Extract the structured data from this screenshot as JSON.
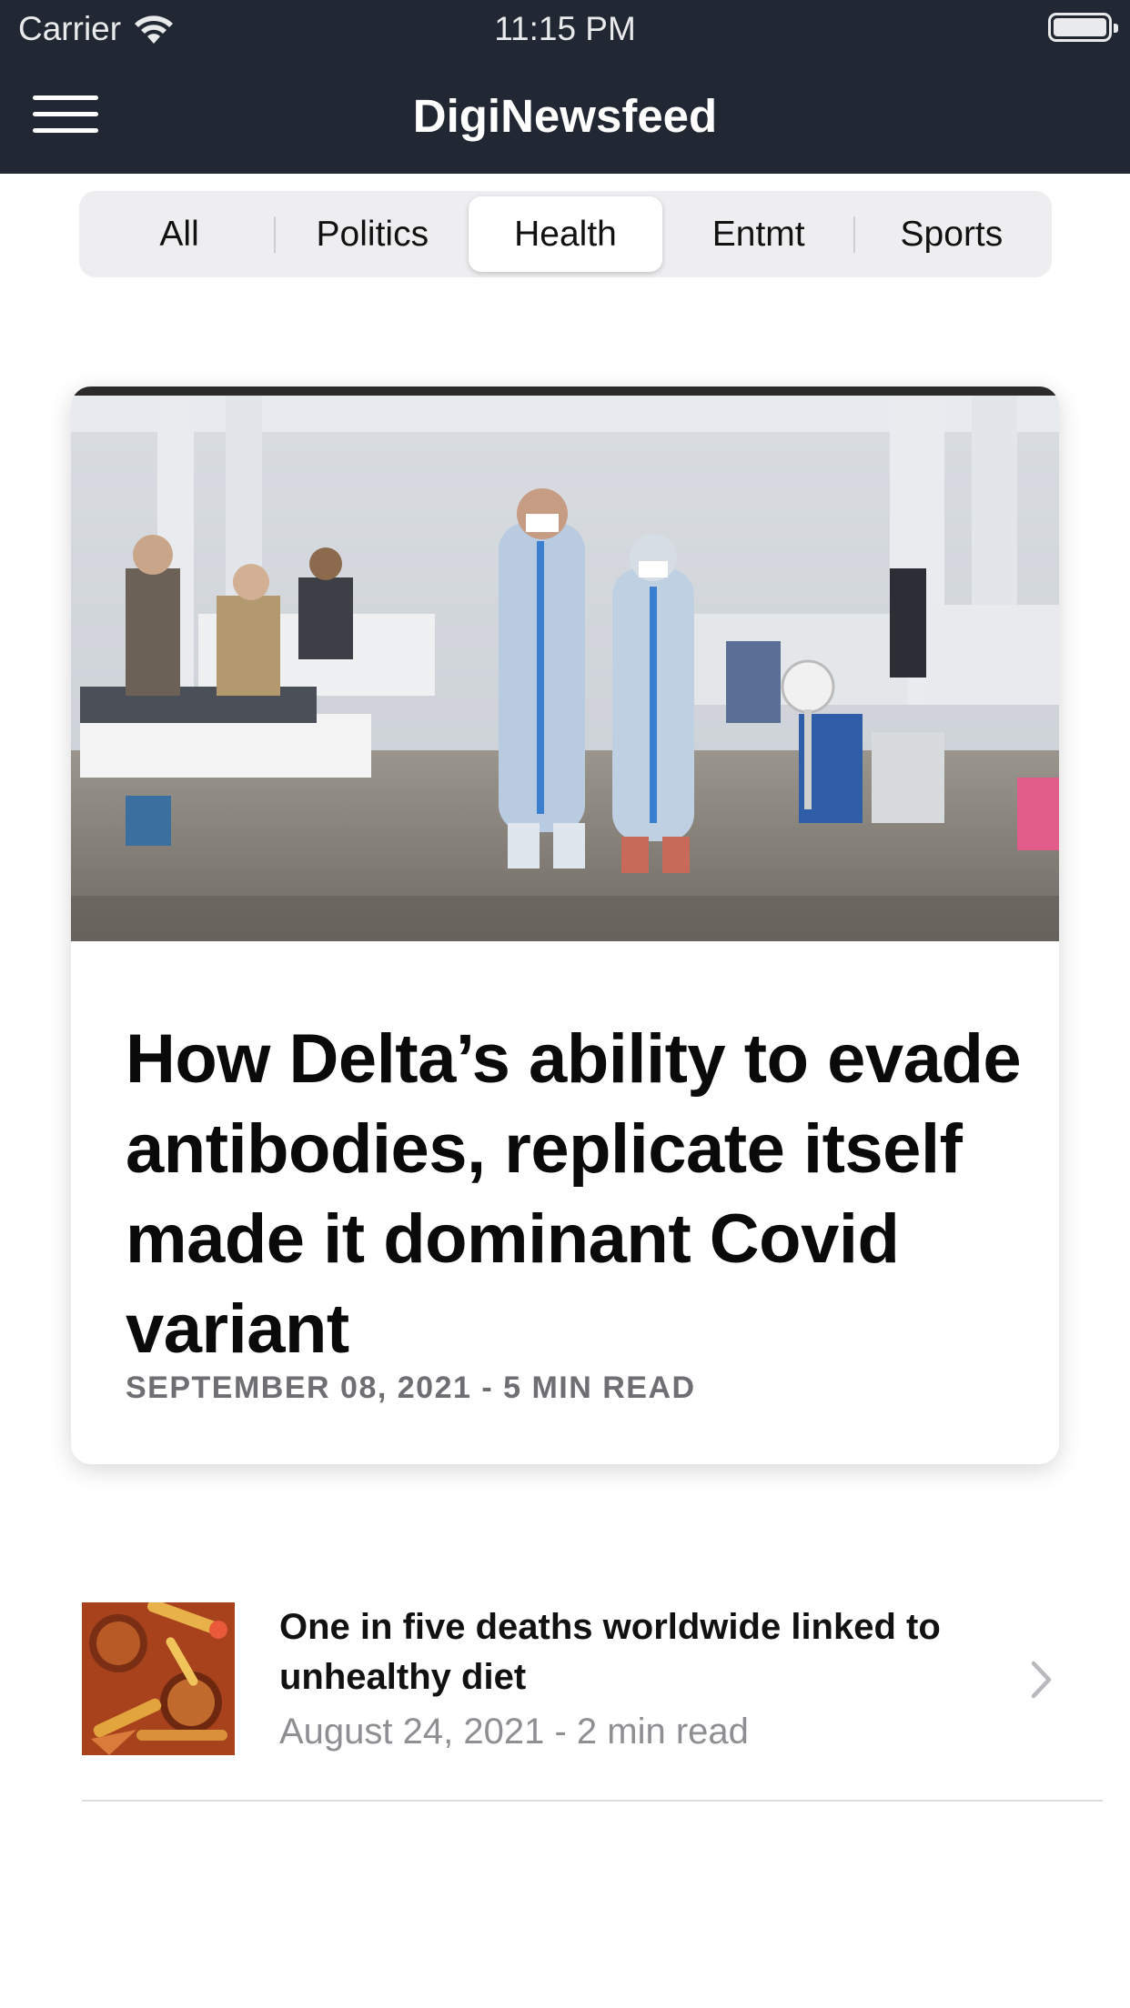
{
  "status_bar": {
    "carrier": "Carrier",
    "time": "11:15 PM"
  },
  "nav": {
    "title": "DigiNewsfeed",
    "menu_icon": "hamburger-menu-icon",
    "background": "#222833"
  },
  "categories": {
    "tabs": [
      "All",
      "Politics",
      "Health",
      "Entmt",
      "Sports"
    ],
    "selected": "Health"
  },
  "featured": {
    "image": "hospital-ward-photo",
    "title": "How Delta’s ability to evade antibodies, replicate itself made it dominant Covid variant",
    "meta": "SEPTEMBER 08, 2021 - 5 MIN READ"
  },
  "articles": [
    {
      "image": "fast-food-photo",
      "title": "One in five deaths worldwide linked to unhealthy diet",
      "meta": "August 24, 2021 - 2 min read",
      "chevron_icon": "chevron-right-icon"
    }
  ]
}
